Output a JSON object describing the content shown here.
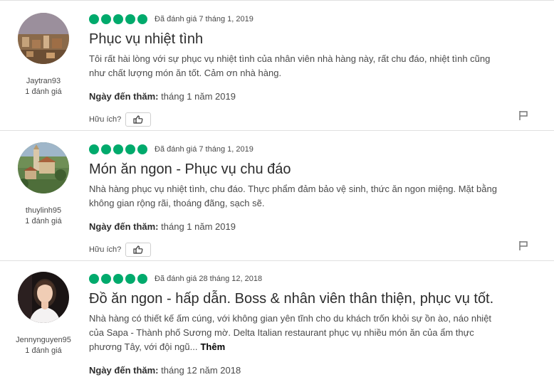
{
  "reviews": [
    {
      "username": "Jaytran93",
      "contributions": "1 đánh giá",
      "rating": 5,
      "rating_date": "Đã đánh giá 7 tháng 1, 2019",
      "title": "Phục vụ nhiệt tình",
      "body": "Tôi rất hài lòng với sự phục vụ nhiệt tình của nhân viên nhà hàng này, rất chu đáo, nhiệt tình cũng như chất lượng món ăn tốt. Cảm ơn nhà hàng.",
      "visit_label": "Ngày đến thăm:",
      "visit_value": "tháng 1 năm 2019",
      "helpful_label": "Hữu ích?",
      "avatar_icon": "city-landscape-photo",
      "thumb_icon": "thumbs-up-icon",
      "flag_icon": "flag-icon"
    },
    {
      "username": "thuylinh95",
      "contributions": "1 đánh giá",
      "rating": 5,
      "rating_date": "Đã đánh giá 7 tháng 1, 2019",
      "title": "Món ăn ngon - Phục vụ chu đáo",
      "body": "Nhà hàng phục vụ nhiệt tình, chu đáo. Thực phẩm đảm bảo vệ sinh, thức ăn ngon miệng. Mặt bằng không gian rộng rãi, thoáng đãng, sạch sẽ.",
      "visit_label": "Ngày đến thăm:",
      "visit_value": "tháng 1 năm 2019",
      "helpful_label": "Hữu ích?",
      "avatar_icon": "church-village-photo",
      "thumb_icon": "thumbs-up-icon",
      "flag_icon": "flag-icon"
    },
    {
      "username": "Jennynguyen95",
      "contributions": "1 đánh giá",
      "rating": 5,
      "rating_date": "Đã đánh giá 28 tháng 12, 2018",
      "title": "Đồ ăn ngon - hấp dẫn. Boss & nhân viên thân thiện, phục vụ tốt.",
      "body": "Nhà hàng có thiết kế ấm cúng, với không gian yên tĩnh cho du khách trốn khỏi sự ồn ào, náo nhiệt của Sapa - Thành phố Sương mờ. Delta Italian restaurant phục vụ nhiều món ăn của ẩm thực phương Tây, với đội ngũ...",
      "more_label": "Thêm",
      "visit_label": "Ngày đến thăm:",
      "visit_value": "tháng 12 năm 2018",
      "avatar_icon": "woman-portrait-photo"
    }
  ],
  "colors": {
    "rating_bubble": "#00aa6c",
    "divider": "#e0e0e0",
    "text": "#4a4a4a",
    "title": "#2c2c2c"
  }
}
